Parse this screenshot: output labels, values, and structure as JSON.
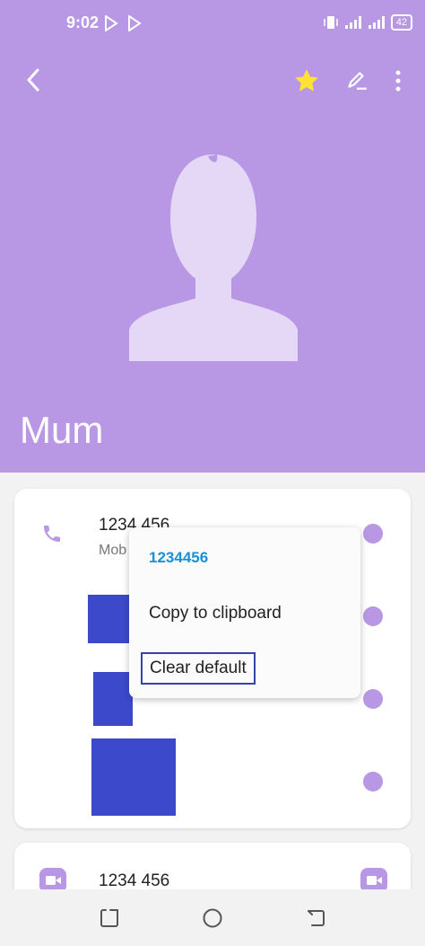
{
  "status_bar": {
    "time": "9:02",
    "battery": "42"
  },
  "contact": {
    "name": "Mum"
  },
  "numbers": [
    {
      "number": "1234 456",
      "type": "Mob"
    }
  ],
  "video_number": "1234 456",
  "popup": {
    "number": "1234456",
    "copy_label": "Copy to clipboard",
    "clear_label": "Clear default"
  },
  "colors": {
    "header": "#b897e4",
    "accent": "#b897e4",
    "popup_number": "#1a8fd1",
    "redaction": "#3c49cb"
  },
  "icons": [
    "back-icon",
    "star-icon",
    "edit-icon",
    "more-icon",
    "phone-icon",
    "message-icon",
    "video-icon",
    "recent-apps-icon",
    "home-icon",
    "back-nav-icon"
  ]
}
